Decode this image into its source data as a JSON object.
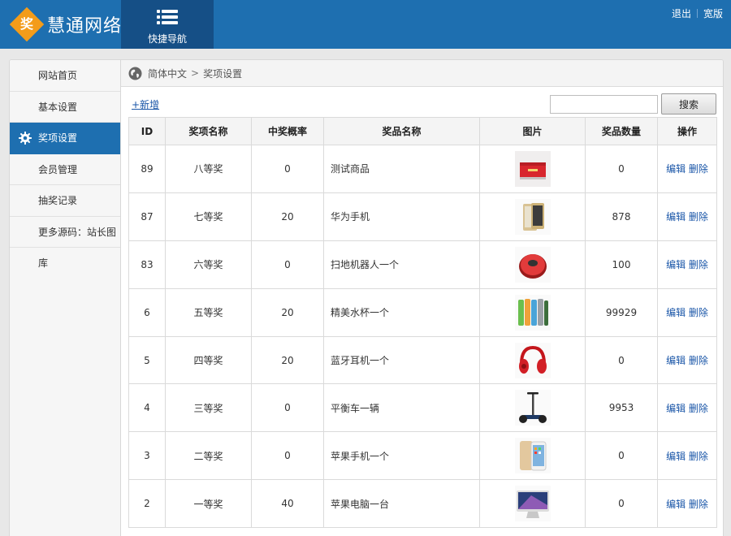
{
  "header": {
    "logo_char": "奖",
    "brand": "慧通网络",
    "quicknav_label": "快捷导航",
    "logout": "退出",
    "wide": "宽版"
  },
  "sidebar": {
    "items": [
      {
        "label": "网站首页"
      },
      {
        "label": "基本设置"
      },
      {
        "label": "奖项设置"
      },
      {
        "label": "会员管理"
      },
      {
        "label": "抽奖记录"
      },
      {
        "label": "更多源码：站长图库"
      }
    ],
    "active_index": 2
  },
  "breadcrumb": {
    "root": "简体中文",
    "sep": ">",
    "current": "奖项设置"
  },
  "toolbar": {
    "add_label": "+新增",
    "search_value": "",
    "search_label": "搜索"
  },
  "table": {
    "headers": [
      "ID",
      "奖项名称",
      "中奖概率",
      "奖品名称",
      "图片",
      "奖品数量",
      "操作"
    ],
    "edit_label": "编辑",
    "delete_label": "删除",
    "rows": [
      {
        "id": "89",
        "level": "八等奖",
        "prob": "0",
        "name": "测试商品",
        "image": "red-gift-box",
        "qty": "0"
      },
      {
        "id": "87",
        "level": "七等奖",
        "prob": "20",
        "name": "华为手机",
        "image": "gold-smartphone",
        "qty": "878"
      },
      {
        "id": "83",
        "level": "六等奖",
        "prob": "0",
        "name": "扫地机器人一个",
        "image": "robot-vacuum",
        "qty": "100"
      },
      {
        "id": "6",
        "level": "五等奖",
        "prob": "20",
        "name": "精美水杯一个",
        "image": "water-bottles",
        "qty": "99929"
      },
      {
        "id": "5",
        "level": "四等奖",
        "prob": "20",
        "name": "蓝牙耳机一个",
        "image": "red-headphones",
        "qty": "0"
      },
      {
        "id": "4",
        "level": "三等奖",
        "prob": "0",
        "name": "平衡车一辆",
        "image": "balance-scooter",
        "qty": "9953"
      },
      {
        "id": "3",
        "level": "二等奖",
        "prob": "0",
        "name": "苹果手机一个",
        "image": "iphone-gold",
        "qty": "0"
      },
      {
        "id": "2",
        "level": "一等奖",
        "prob": "40",
        "name": "苹果电脑一台",
        "image": "imac-desktop",
        "qty": "0"
      }
    ]
  },
  "colors": {
    "header_bg": "#1e6fb0",
    "quicknav_bg": "#154f86",
    "logo_accent": "#f39c1a",
    "link": "#1a56a8"
  }
}
